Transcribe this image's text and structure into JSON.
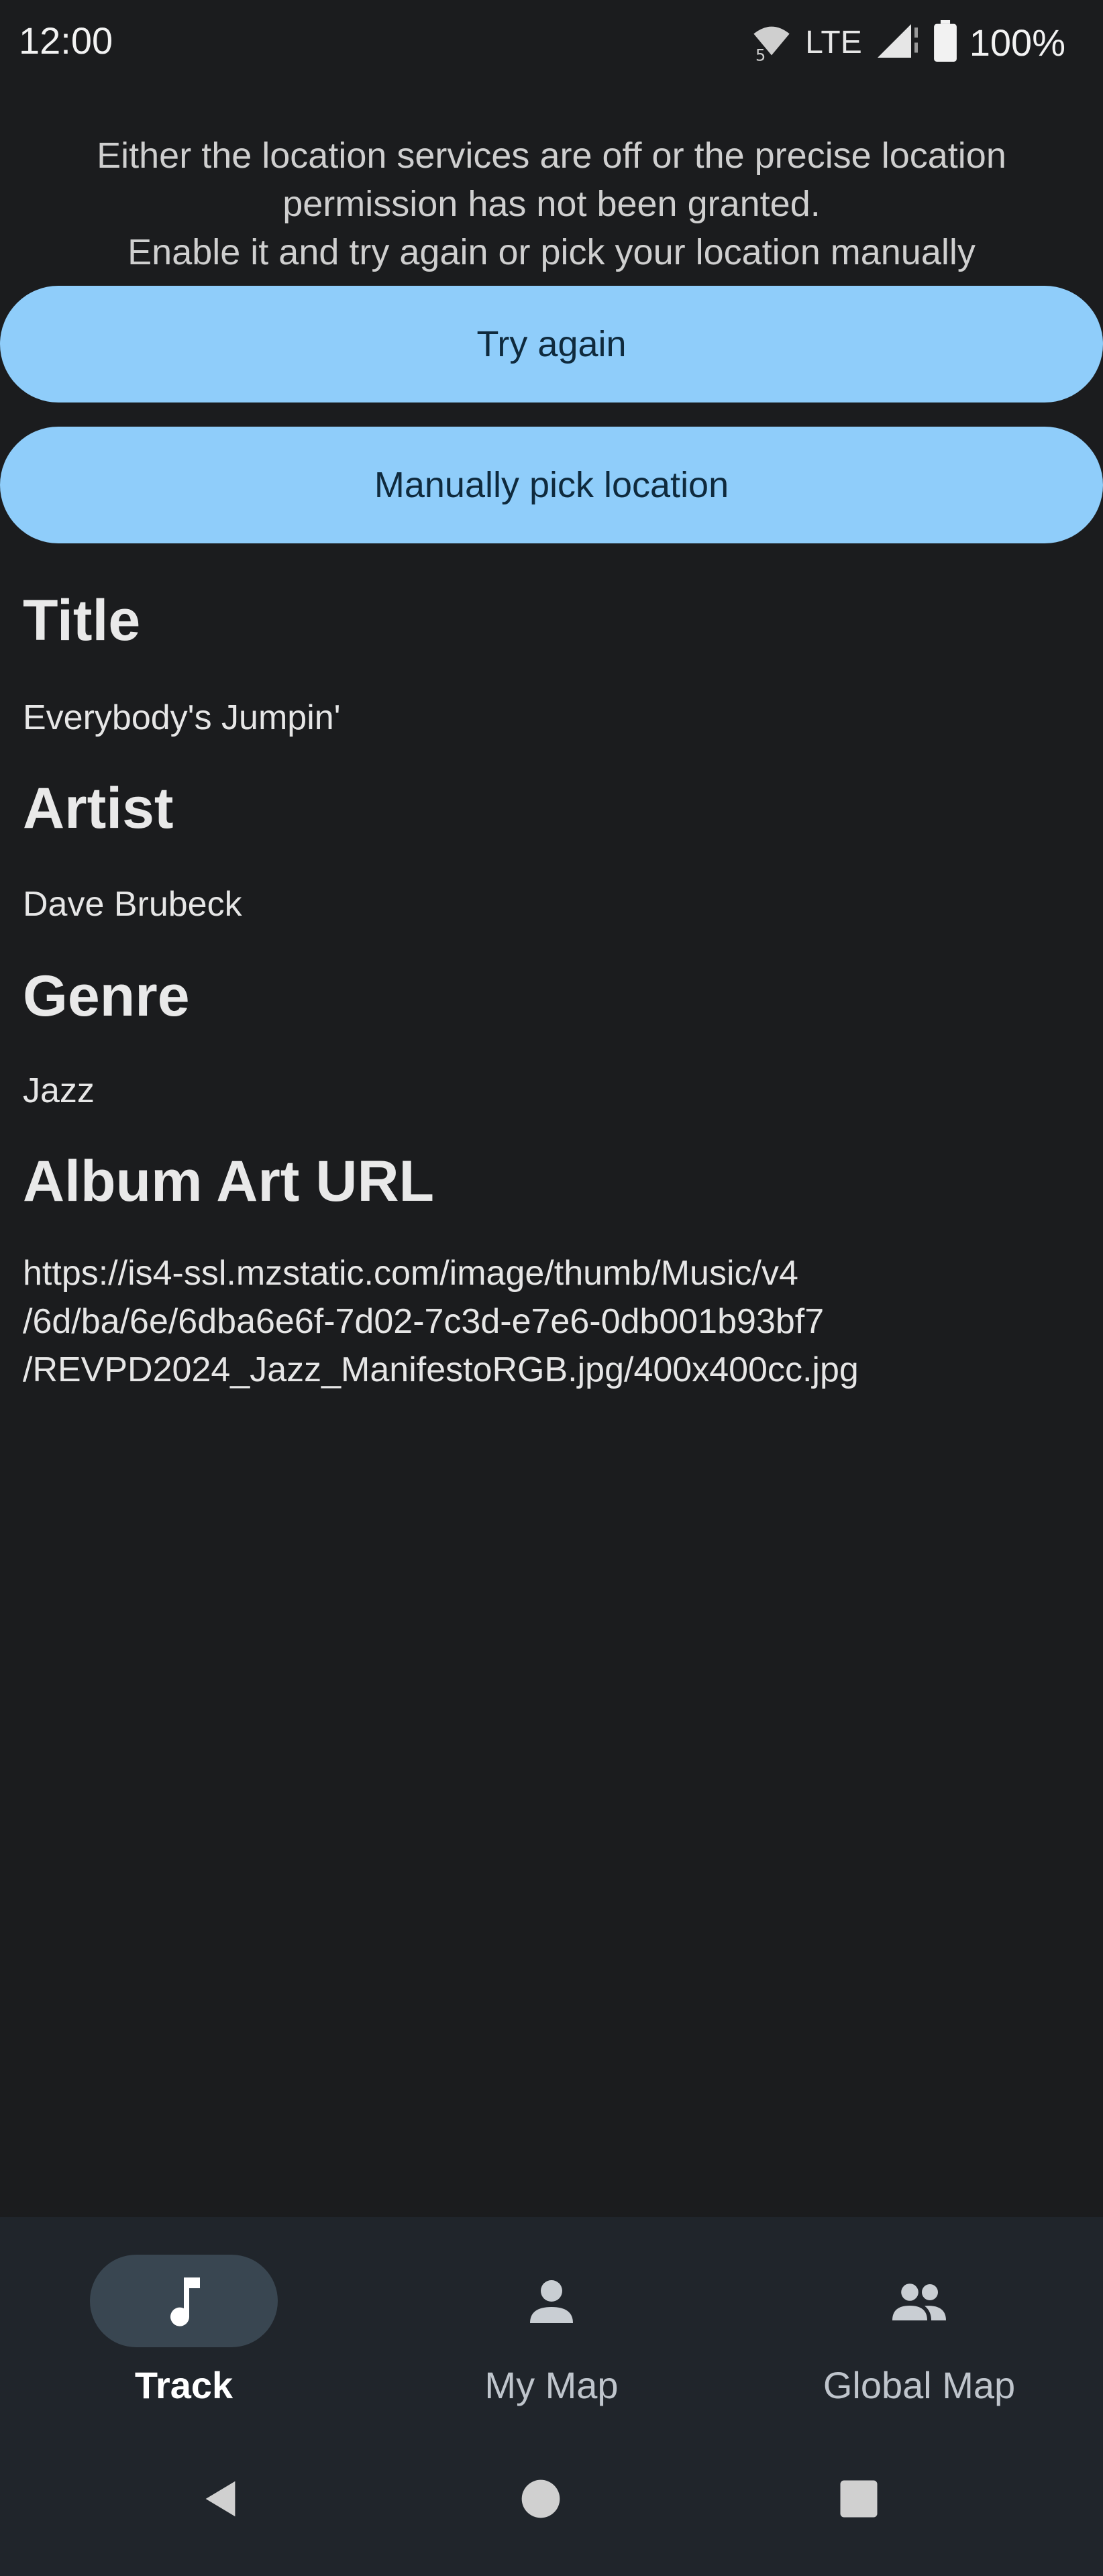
{
  "status_bar": {
    "time": "12:00",
    "network": "LTE",
    "battery": "100%",
    "icons": [
      "wifi-icon",
      "signal-icon",
      "battery-icon"
    ]
  },
  "message": {
    "lines": [
      "Either the location services are off or the precise location",
      "permission has not been granted.",
      "Enable it and try again or pick your location manually"
    ]
  },
  "buttons": {
    "try_again": "Try again",
    "manual_pick": "Manually pick location"
  },
  "track_info": {
    "title_label": "Title",
    "title_value": "Everybody's Jumpin'",
    "artist_label": "Artist",
    "artist_value": "Dave Brubeck",
    "genre_label": "Genre",
    "genre_value": "Jazz",
    "album_art_label": "Album Art URL",
    "album_art_lines": [
      "https://is4-ssl.mzstatic.com/image/thumb/Music/v4",
      "/6d/ba/6e/6dba6e6f-7d02-7c3d-e7e6-0db001b93bf7",
      "/REVPD2024_Jazz_ManifestoRGB.jpg/400x400cc.jpg"
    ]
  },
  "bottom_nav": {
    "items": [
      {
        "label": "Track",
        "icon": "music-note-icon",
        "active": true
      },
      {
        "label": "My Map",
        "icon": "person-icon",
        "active": false
      },
      {
        "label": "Global Map",
        "icon": "people-icon",
        "active": false
      }
    ]
  },
  "system_nav": {
    "icons": [
      "back-icon",
      "home-icon",
      "recents-icon"
    ]
  },
  "colors": {
    "background": "#1b1c1e",
    "button": "#8fcdfa",
    "nav_background": "#20252b",
    "active_pill": "#394651"
  }
}
